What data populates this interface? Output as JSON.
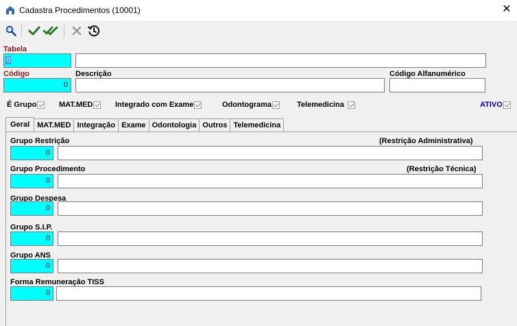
{
  "window": {
    "title": "Cadastra Procedimentos (10001)",
    "close": "✕"
  },
  "toolbar": {
    "search": "search",
    "confirm": "confirm",
    "confirm_all": "confirm-all",
    "cancel": "cancel",
    "history": "history"
  },
  "header": {
    "tabela_label": "Tabela",
    "tabela_value": "0",
    "codigo_label": "Código",
    "codigo_value": "0",
    "descricao_label": "Descrição",
    "descricao_value": "",
    "codigo_alfa_label": "Código Alfanumérico",
    "codigo_alfa_value": ""
  },
  "flags": {
    "e_grupo": "É Grupo",
    "matmed": "MAT.MED",
    "integrado": "Integrado com Exame",
    "odontograma": "Odontograma",
    "telemedicina": "Telemedicina",
    "ativo": "ATIVO"
  },
  "tabs": [
    "Geral",
    "MAT.MED",
    "Integração",
    "Exame",
    "Odontologia",
    "Outros",
    "Telemedicina"
  ],
  "geral": {
    "grupo_restricao": {
      "label": "Grupo Restrição",
      "note": "(Restrição Administrativa)",
      "value": "0"
    },
    "grupo_procedimento": {
      "label": "Grupo Procedimento",
      "note": "(Restrição Técnica)",
      "value": "0"
    },
    "grupo_despesa": {
      "label": "Grupo Despesa",
      "value": "0"
    },
    "grupo_sip": {
      "label": "Grupo S.I.P.",
      "value": "0"
    },
    "grupo_ans": {
      "label": "Grupo ANS",
      "value": "0"
    },
    "forma_remuneracao": {
      "label": "Forma Remuneração TISS",
      "value": "0"
    }
  }
}
